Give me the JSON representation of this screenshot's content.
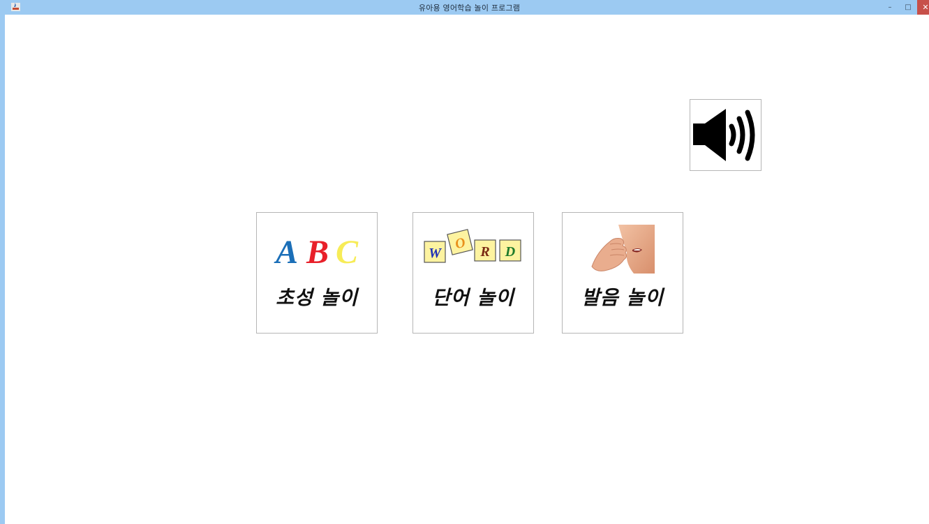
{
  "window": {
    "title": "유아용 영어학습 놀이 프로그램",
    "controls": {
      "minimize": "–",
      "maximize": "□",
      "close": "✕"
    }
  },
  "sound": {
    "icon": "speaker-volume-icon"
  },
  "cards": [
    {
      "label": "초성 놀이",
      "image": "abc-letters-image",
      "letters": [
        "A",
        "B",
        "C"
      ],
      "colors": [
        "#1b6fb8",
        "#e8202a",
        "#f7ec57"
      ]
    },
    {
      "label": "단어 놀이",
      "image": "word-blocks-image",
      "letters": [
        "W",
        "O",
        "R",
        "D"
      ],
      "colors": [
        "#1f2fb7",
        "#e8901c",
        "#7a2a14",
        "#1e7a2a"
      ]
    },
    {
      "label": "발음 놀이",
      "image": "whisper-mouth-image"
    }
  ]
}
